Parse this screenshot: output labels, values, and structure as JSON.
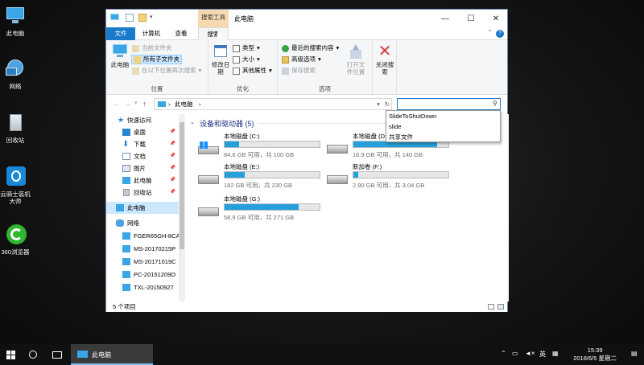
{
  "desktop": {
    "icons": [
      {
        "label": "此电脑"
      },
      {
        "label": "网络"
      },
      {
        "label": "回收站"
      },
      {
        "label": "云骑士装机大师"
      },
      {
        "label": "360浏览器"
      }
    ]
  },
  "window": {
    "title": "此电脑",
    "context_tab_header": "搜索工具",
    "tabs": [
      "文件",
      "计算机",
      "查看",
      "搜索"
    ],
    "help_label": "?",
    "ribbon": {
      "location_group": {
        "label": "位置",
        "this_pc": "此电脑",
        "current_folder": "当前文件夹",
        "all_subfolders": "所有子文件夹",
        "search_again_in": "在以下位置再次搜索"
      },
      "refine_group": {
        "label": "优化",
        "date_modified": "修改日期",
        "kind": "类型",
        "size": "大小",
        "other_properties": "其他属性"
      },
      "options_group": {
        "label": "选项",
        "recent_searches": "最近的搜索内容",
        "advanced_options": "高级选项",
        "save_search": "保存搜索",
        "open_file_location": "打开文件位置"
      },
      "close_search": "关闭搜索"
    },
    "address": {
      "path": "此电脑",
      "separator": "›"
    },
    "nav_pane": {
      "items": [
        {
          "label": "快速访问",
          "pinned": false
        },
        {
          "label": "桌面",
          "pinned": true
        },
        {
          "label": "下载",
          "pinned": true
        },
        {
          "label": "文档",
          "pinned": true
        },
        {
          "label": "图片",
          "pinned": true
        },
        {
          "label": "此电脑",
          "pinned": true
        },
        {
          "label": "回收站",
          "pinned": true
        },
        {
          "label": "此电脑",
          "pinned": false
        },
        {
          "label": "网络",
          "pinned": false
        },
        {
          "label": "FGER65GH-8CA",
          "pinned": false
        },
        {
          "label": "MS-20170215P",
          "pinned": false
        },
        {
          "label": "MS-20171019C",
          "pinned": false
        },
        {
          "label": "PC-20151209O",
          "pinned": false
        },
        {
          "label": "TXL-20150927",
          "pinned": false
        }
      ]
    },
    "group_header": "设备和驱动器 (5)",
    "drives": [
      {
        "name": "本地磁盘 (C:)",
        "free_text": "84.6 GB 可用，共 100 GB",
        "used_fraction": 0.15
      },
      {
        "name": "本地磁盘 (D:)",
        "free_text": "16.9 GB 可用，共 140 GB",
        "used_fraction": 0.88
      },
      {
        "name": "本地磁盘 (E:)",
        "free_text": "182 GB 可用，共 230 GB",
        "used_fraction": 0.21
      },
      {
        "name": "新加卷 (F:)",
        "free_text": "2.90 GB 可用，共 3.04 GB",
        "used_fraction": 0.05
      },
      {
        "name": "本地磁盘 (G:)",
        "free_text": "58.9 GB 可用，共 271 GB",
        "used_fraction": 0.78
      }
    ],
    "search_suggestions": [
      "SlideToShutDown",
      "slide",
      "共享文件"
    ],
    "status": "5 个项目"
  },
  "taskbar": {
    "app_label": "此电脑",
    "ime": "英",
    "time": "15:39",
    "date": "2018/6/5 星期二"
  },
  "colors": {
    "accent": "#1979ca",
    "bar_fill": "#26a0da",
    "close_x": "#d83b3b"
  }
}
